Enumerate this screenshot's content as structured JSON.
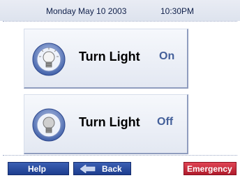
{
  "header": {
    "date": "Monday May 10  2003",
    "time": "10:30PM"
  },
  "buttons": {
    "light_on": {
      "label": "Turn Light",
      "state": "On",
      "icon": "lightbulb-on-icon"
    },
    "light_off": {
      "label": "Turn Light",
      "state": "Off",
      "icon": "lightbulb-off-icon"
    }
  },
  "footer": {
    "help": "Help",
    "back": "Back",
    "back_icon": "left-arrow-icon",
    "emergency": "Emergency"
  },
  "colors": {
    "nav_blue": "#1d3d8e",
    "emergency_red": "#b01c2c",
    "state_text": "#44609a"
  }
}
